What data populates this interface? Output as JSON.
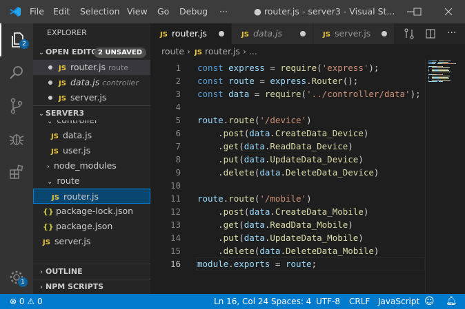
{
  "titlebar": {
    "menus": [
      "File",
      "Edit",
      "Selection",
      "View",
      "Go",
      "Debug"
    ],
    "more": "···",
    "title": "● router.js - server3 - Visual St..."
  },
  "activity": {
    "explorer_badge": "2",
    "manage_badge": "1"
  },
  "sidebar": {
    "title": "EXPLORER",
    "open_editors": {
      "label": "OPEN EDITO...",
      "badge": "2 UNSAVED",
      "items": [
        {
          "icon": "JS",
          "name": "router.js",
          "desc": "route",
          "modified": true
        },
        {
          "icon": "JS",
          "name": "data.js",
          "desc": "controller",
          "modified": true
        },
        {
          "icon": "JS",
          "name": "server.js",
          "desc": "",
          "modified": true
        }
      ]
    },
    "folder": {
      "label": "SERVER3",
      "items": [
        {
          "type": "folder",
          "name": "controller"
        },
        {
          "type": "js",
          "name": "data.js"
        },
        {
          "type": "js",
          "name": "user.js"
        },
        {
          "type": "folder-closed",
          "name": "node_modules"
        },
        {
          "type": "folder-open",
          "name": "route"
        },
        {
          "type": "js",
          "name": "router.js"
        },
        {
          "type": "json",
          "name": "package-lock.json"
        },
        {
          "type": "json",
          "name": "package.json"
        },
        {
          "type": "js",
          "name": "server.js"
        }
      ]
    },
    "outline": "OUTLINE",
    "npm": "NPM SCRIPTS"
  },
  "tabs": [
    {
      "icon": "JS",
      "name": "router.js"
    },
    {
      "icon": "JS",
      "name": "data.js"
    },
    {
      "icon": "JS",
      "name": "server.js"
    }
  ],
  "breadcrumb": {
    "folder": "route",
    "file": "router.js",
    "more": "..."
  },
  "editor": {
    "lines": [
      [
        [
          "kw",
          "const "
        ],
        [
          "var",
          "express"
        ],
        [
          "",
          "  = "
        ],
        [
          "fn",
          "require"
        ],
        [
          "",
          "("
        ],
        [
          "str",
          "'express'"
        ],
        [
          "",
          ");"
        ]
      ],
      [
        [
          "kw",
          "const "
        ],
        [
          "var",
          "route"
        ],
        [
          "",
          "  = "
        ],
        [
          "var",
          "express"
        ],
        [
          "",
          "."
        ],
        [
          "fn",
          "Router"
        ],
        [
          "",
          "();"
        ]
      ],
      [
        [
          "kw",
          "const "
        ],
        [
          "var",
          "data"
        ],
        [
          "",
          "  = "
        ],
        [
          "fn",
          "require"
        ],
        [
          "",
          "("
        ],
        [
          "str",
          "'../controller/data'"
        ],
        [
          "",
          ");"
        ]
      ],
      [],
      [
        [
          "var",
          "route"
        ],
        [
          "",
          "."
        ],
        [
          "fn",
          "route"
        ],
        [
          "",
          "("
        ],
        [
          "str",
          "'/device'"
        ],
        [
          "",
          ")"
        ]
      ],
      [
        [
          "",
          "    ."
        ],
        [
          "fn",
          "post"
        ],
        [
          "",
          "("
        ],
        [
          "var",
          "data"
        ],
        [
          "",
          "."
        ],
        [
          "fn",
          "CreateData_Device"
        ],
        [
          "",
          ")"
        ]
      ],
      [
        [
          "",
          "    ."
        ],
        [
          "fn",
          "get"
        ],
        [
          "",
          "("
        ],
        [
          "var",
          "data"
        ],
        [
          "",
          "."
        ],
        [
          "fn",
          "ReadData_Device"
        ],
        [
          "",
          ")"
        ]
      ],
      [
        [
          "",
          "    ."
        ],
        [
          "fn",
          "put"
        ],
        [
          "",
          "("
        ],
        [
          "var",
          "data"
        ],
        [
          "",
          "."
        ],
        [
          "fn",
          "UpdateData_Device"
        ],
        [
          "",
          ")"
        ]
      ],
      [
        [
          "",
          "    ."
        ],
        [
          "fn",
          "delete"
        ],
        [
          "",
          "("
        ],
        [
          "var",
          "data"
        ],
        [
          "",
          "."
        ],
        [
          "fn",
          "DeleteData_Device"
        ],
        [
          "",
          ")"
        ]
      ],
      [],
      [
        [
          "var",
          "route"
        ],
        [
          "",
          "."
        ],
        [
          "fn",
          "route"
        ],
        [
          "",
          "("
        ],
        [
          "str",
          "'/mobile'"
        ],
        [
          "",
          ")"
        ]
      ],
      [
        [
          "",
          "    ."
        ],
        [
          "fn",
          "post"
        ],
        [
          "",
          "("
        ],
        [
          "var",
          "data"
        ],
        [
          "",
          "."
        ],
        [
          "fn",
          "CreateData_Mobile"
        ],
        [
          "",
          ")"
        ]
      ],
      [
        [
          "",
          "    ."
        ],
        [
          "fn",
          "get"
        ],
        [
          "",
          "("
        ],
        [
          "var",
          "data"
        ],
        [
          "",
          "."
        ],
        [
          "fn",
          "ReadData_Mobile"
        ],
        [
          "",
          ")"
        ]
      ],
      [
        [
          "",
          "    ."
        ],
        [
          "fn",
          "put"
        ],
        [
          "",
          "("
        ],
        [
          "var",
          "data"
        ],
        [
          "",
          "."
        ],
        [
          "fn",
          "UpdateData_Mobile"
        ],
        [
          "",
          ")"
        ]
      ],
      [
        [
          "",
          "    ."
        ],
        [
          "fn",
          "delete"
        ],
        [
          "",
          "("
        ],
        [
          "var",
          "data"
        ],
        [
          "",
          "."
        ],
        [
          "fn",
          "DeleteData_Mobile"
        ],
        [
          "",
          ")"
        ]
      ],
      [
        [
          "var",
          "module"
        ],
        [
          "",
          "."
        ],
        [
          "var",
          "exports"
        ],
        [
          "",
          " = "
        ],
        [
          "var",
          "route"
        ],
        [
          "",
          ";"
        ]
      ]
    ],
    "current_line": 16
  },
  "statusbar": {
    "errors": "0",
    "warnings": "0",
    "position": "Ln 16, Col 24",
    "spaces": "Spaces: 4",
    "encoding": "UTF-8",
    "eol": "CRLF",
    "language": "JavaScript"
  }
}
